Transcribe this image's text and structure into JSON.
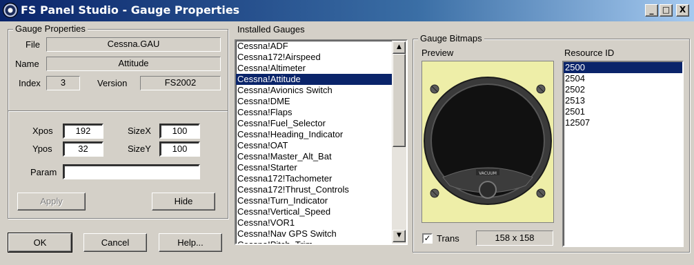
{
  "window": {
    "title": "FS Panel Studio - Gauge Properties",
    "controls": [
      "_",
      "□",
      "X"
    ]
  },
  "gauge_properties": {
    "legend": "Gauge Properties",
    "file_label": "File",
    "file_value": "Cessna.GAU",
    "name_label": "Name",
    "name_value": "Attitude",
    "index_label": "Index",
    "index_value": "3",
    "version_label": "Version",
    "version_value": "FS2002",
    "xpos_label": "Xpos",
    "xpos_value": "192",
    "ypos_label": "Ypos",
    "ypos_value": "32",
    "sizex_label": "SizeX",
    "sizex_value": "100",
    "sizey_label": "SizeY",
    "sizey_value": "100",
    "param_label": "Param",
    "param_value": "",
    "apply_label": "Apply",
    "hide_label": "Hide"
  },
  "footer": {
    "ok_label": "OK",
    "cancel_label": "Cancel",
    "help_label": "Help..."
  },
  "installed_gauges": {
    "legend": "Installed Gauges",
    "items": [
      "Cessna!ADF",
      "Cessna172!Airspeed",
      "Cessna!Altimeter",
      "Cessna!Attitude",
      "Cessna!Avionics Switch",
      "Cessna!DME",
      "Cessna!Flaps",
      "Cessna!Fuel_Selector",
      "Cessna!Heading_Indicator",
      "Cessna!OAT",
      "Cessna!Master_Alt_Bat",
      "Cessna!Starter",
      "Cessna172!Tachometer",
      "Cessna172!Thrust_Controls",
      "Cessna!Turn_Indicator",
      "Cessna!Vertical_Speed",
      "Cessna!VOR1",
      "Cessna!Nav GPS Switch",
      "Cessna!Pitch_Trim"
    ],
    "selected_index": 3
  },
  "gauge_bitmaps": {
    "legend": "Gauge Bitmaps",
    "preview_label": "Preview",
    "gauge_text": "VACUUM",
    "resource_label": "Resource ID",
    "resource_ids": [
      "2500",
      "2504",
      "2502",
      "2513",
      "2501",
      "12507"
    ],
    "selected_index": 0,
    "trans_label": "Trans",
    "trans_checked": true,
    "size_value": "158 x 158"
  },
  "colors": {
    "selection": "#0a246a",
    "preview_bg": "#eeeea8",
    "face": "#d4d0c8"
  }
}
